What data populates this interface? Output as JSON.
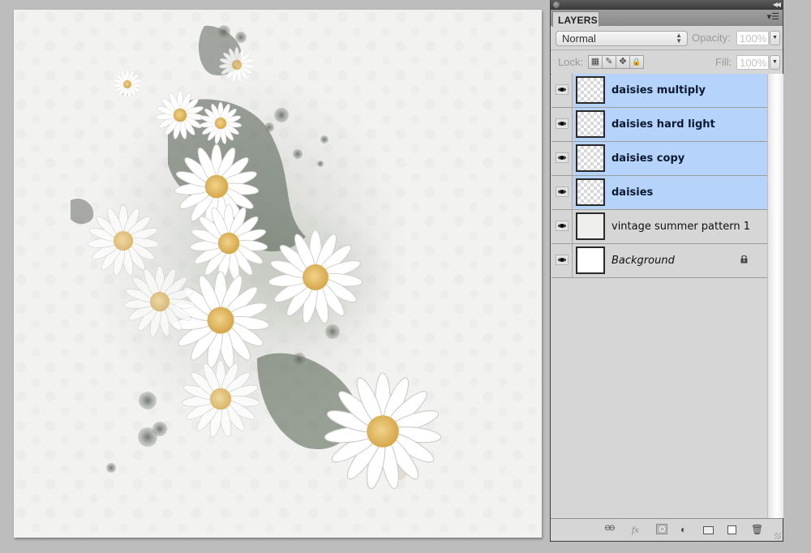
{
  "canvas": {
    "description": "Scrapbook page with watercolor daisies and ink splatters on vintage summer pattern"
  },
  "panel": {
    "tab_label": "LAYERS",
    "panel_menu_icon": "panel-menu-icon",
    "collapse_icon": "double-chevron-left",
    "blend_mode": "Normal",
    "opacity_label": "Opacity:",
    "opacity_value": "100%",
    "lock_label": "Lock:",
    "lock_buttons": [
      {
        "name": "lock-transparent-pixels",
        "glyph": "▦"
      },
      {
        "name": "lock-image-pixels",
        "glyph": "✎"
      },
      {
        "name": "lock-position",
        "glyph": "✥"
      },
      {
        "name": "lock-all",
        "glyph": "🔒"
      }
    ],
    "fill_label": "Fill:",
    "fill_value": "100%"
  },
  "layers": [
    {
      "name": "daisies multiply",
      "visible": true,
      "selected": true,
      "thumb": "checker",
      "italic": false,
      "locked": false
    },
    {
      "name": "daisies hard light",
      "visible": true,
      "selected": true,
      "thumb": "checker",
      "italic": false,
      "locked": false
    },
    {
      "name": "daisies copy",
      "visible": true,
      "selected": true,
      "thumb": "checker",
      "italic": false,
      "locked": false
    },
    {
      "name": "daisies",
      "visible": true,
      "selected": true,
      "thumb": "checker",
      "italic": false,
      "locked": false
    },
    {
      "name": "vintage summer pattern 1",
      "visible": true,
      "selected": false,
      "thumb": "pattern",
      "italic": false,
      "locked": false
    },
    {
      "name": "Background",
      "visible": true,
      "selected": false,
      "thumb": "white",
      "italic": true,
      "locked": true
    }
  ],
  "footer_buttons": [
    {
      "name": "link-layers",
      "glyph": "⊖⊖"
    },
    {
      "name": "add-layer-style",
      "glyph": "fx"
    },
    {
      "name": "add-layer-mask",
      "glyph": "◙"
    },
    {
      "name": "new-adjustment-layer",
      "glyph": "◐"
    },
    {
      "name": "new-group",
      "glyph": "▭"
    },
    {
      "name": "new-layer",
      "glyph": "◲"
    },
    {
      "name": "delete-layer",
      "glyph": "🗑"
    }
  ]
}
